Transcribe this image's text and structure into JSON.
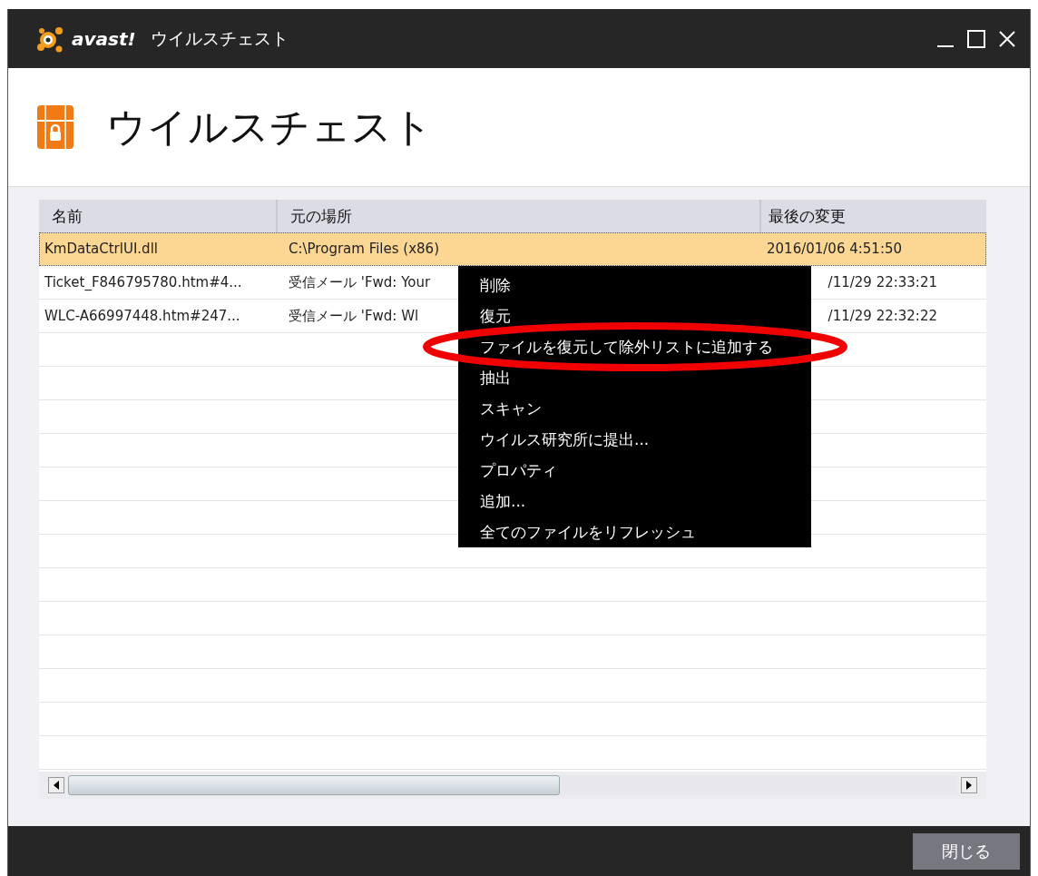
{
  "window": {
    "app_name": "avast!",
    "title": "ウイルスチェスト"
  },
  "header": {
    "title": "ウイルスチェスト"
  },
  "table": {
    "columns": [
      "名前",
      "元の場所",
      "最後の変更"
    ],
    "rows": [
      {
        "name": "KmDataCtrlUI.dll",
        "location": "C:\\Program Files (x86)",
        "modified": "2016/01/06 4:51:50",
        "selected": true
      },
      {
        "name": "Ticket_F846795780.htm#4...",
        "location": "受信メール 'Fwd: Your",
        "modified": "/11/29 22:33:21",
        "selected": false
      },
      {
        "name": "WLC-A66997448.htm#247...",
        "location": "受信メール 'Fwd: Wl",
        "modified": "/11/29 22:32:22",
        "selected": false
      }
    ]
  },
  "context_menu": {
    "items": [
      {
        "label": "削除",
        "highlighted": false
      },
      {
        "label": "復元",
        "highlighted": false
      },
      {
        "label": "ファイルを復元して除外リストに追加する",
        "highlighted": true
      },
      {
        "label": "抽出",
        "highlighted": false
      },
      {
        "label": "スキャン",
        "highlighted": false
      },
      {
        "label": "ウイルス研究所に提出...",
        "highlighted": false
      },
      {
        "label": "プロパティ",
        "highlighted": false
      },
      {
        "label": "追加...",
        "highlighted": false
      },
      {
        "label": "全てのファイルをリフレッシュ",
        "highlighted": false
      }
    ]
  },
  "footer": {
    "close_button": "閉じる"
  }
}
